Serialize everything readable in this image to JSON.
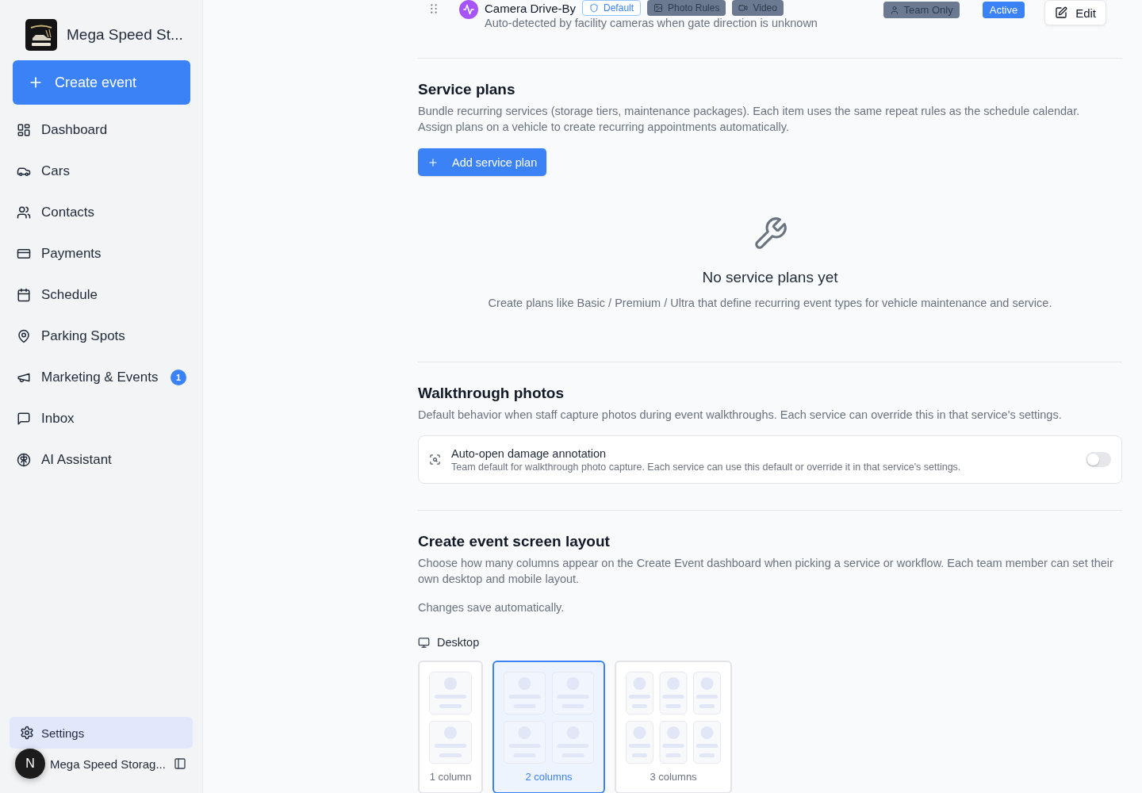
{
  "sidebar": {
    "brand": {
      "name": "Mega Speed St..."
    },
    "create_button": {
      "label": "Create event"
    },
    "nav_items": [
      {
        "label": "Dashboard",
        "selected": false
      },
      {
        "label": "Cars",
        "selected": false
      },
      {
        "label": "Contacts",
        "selected": false
      },
      {
        "label": "Payments",
        "selected": false
      },
      {
        "label": "Schedule",
        "selected": false
      },
      {
        "label": "Parking Spots",
        "selected": false
      },
      {
        "label": "Marketing & Events",
        "selected": false,
        "badge": "1"
      },
      {
        "label": "Inbox",
        "selected": false
      },
      {
        "label": "AI Assistant",
        "selected": false
      }
    ],
    "settings": {
      "label": "Settings",
      "selected": true
    },
    "account": {
      "initial": "N",
      "name": "Mega Speed Storag..."
    }
  },
  "event_type_row": {
    "title": "Camera Drive-By",
    "tags": [
      {
        "label": "Default",
        "kind": "outline"
      },
      {
        "label": "Photo Rules",
        "kind": "muted"
      },
      {
        "label": "Video",
        "kind": "muted"
      }
    ],
    "description": "Auto-detected by facility cameras when gate direction is unknown",
    "visibility": "Team Only",
    "status": "Active",
    "edit_button": "Edit"
  },
  "service_plans": {
    "heading": "Service plans",
    "description": "Bundle recurring services (storage tiers, maintenance packages). Each item uses the same repeat rules as the schedule calendar.\nAssign plans on a vehicle to create recurring appointments automatically.",
    "add_button": "Add service plan",
    "empty_state": {
      "title": "No service plans yet",
      "description": "Create plans like Basic / Premium / Ultra that define recurring event types for vehicle maintenance and service."
    }
  },
  "walkthrough_photos": {
    "heading": "Walkthrough photos",
    "description": "Default behavior when staff capture photos during event walkthroughs. Each service can override this in that service's settings.",
    "setting": {
      "title": "Auto-open damage annotation",
      "description": "Team default for walkthrough photo capture. Each service can use this default or override it in that service's settings.",
      "on": false
    }
  },
  "screen_layout": {
    "heading": "Create event screen layout",
    "description": "Choose how many columns appear on the Create Event dashboard when picking a service or workflow. Each team member can set their own desktop and mobile layout.",
    "note": "Changes save automatically.",
    "device": "Desktop",
    "options": [
      {
        "label": "1 column",
        "kind": "one",
        "selected": false
      },
      {
        "label": "2 columns",
        "kind": "two",
        "selected": true
      },
      {
        "label": "3 columns",
        "kind": "three",
        "selected": false
      }
    ]
  }
}
